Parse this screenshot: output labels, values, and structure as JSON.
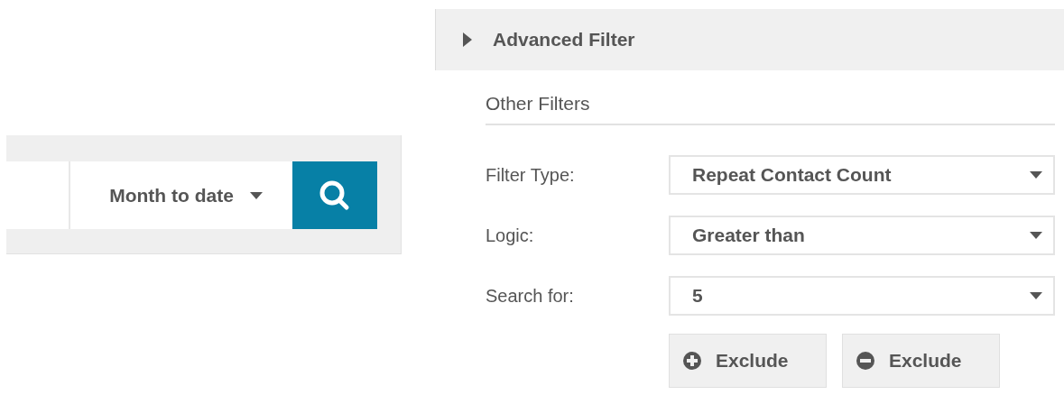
{
  "search_bar": {
    "date_range": "Month to date"
  },
  "advanced_filter": {
    "title": "Advanced Filter",
    "expanded": false
  },
  "other_filters": {
    "heading": "Other Filters",
    "rows": [
      {
        "label": "Filter Type:",
        "value": "Repeat Contact Count"
      },
      {
        "label": "Logic:",
        "value": "Greater than"
      },
      {
        "label": "Search for:",
        "value": "5"
      }
    ],
    "buttons": [
      {
        "kind": "plus",
        "label": "Exclude"
      },
      {
        "kind": "minus",
        "label": "Exclude"
      }
    ]
  }
}
